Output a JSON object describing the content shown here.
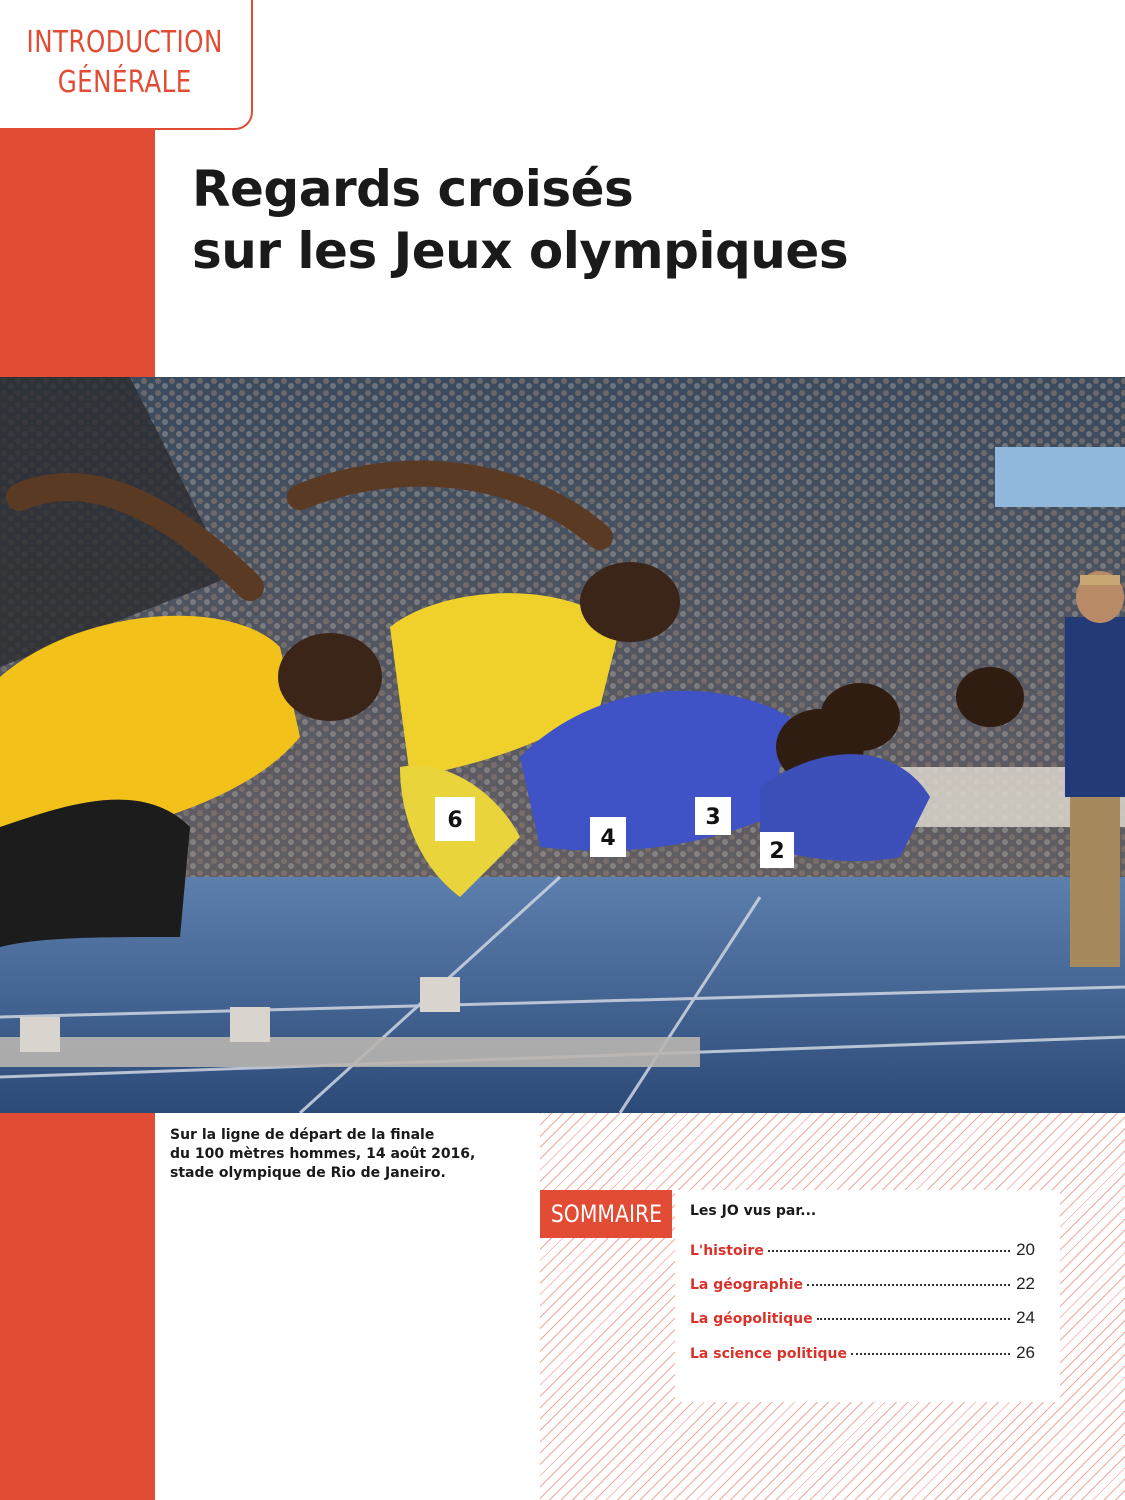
{
  "tab": {
    "line1": "INTRODUCTION",
    "line2": "GÉNÉRALE"
  },
  "title": {
    "line1": "Regards croisés",
    "line2": "sur les Jeux olympiques"
  },
  "photo": {
    "bibs": [
      "6",
      "4",
      "3",
      "2"
    ]
  },
  "caption": {
    "line1": "Sur la ligne de départ de la finale",
    "line2": "du 100 mètres hommes, 14 août 2016,",
    "line3": "stade olympique de Rio de Janeiro."
  },
  "sommaire": {
    "tag": "SOMMAIRE",
    "heading": "Les JO vus par...",
    "items": [
      {
        "label": "L'histoire",
        "page": "20"
      },
      {
        "label": "La géographie",
        "page": "22"
      },
      {
        "label": "La géopolitique",
        "page": "24"
      },
      {
        "label": "La science politique",
        "page": "26"
      }
    ]
  },
  "colors": {
    "accent": "#e24b34",
    "toc_label": "#d8322a"
  }
}
